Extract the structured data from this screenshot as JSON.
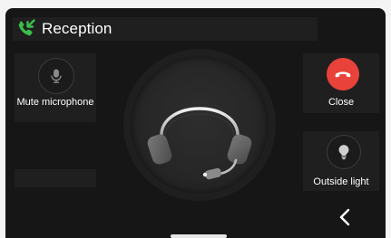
{
  "header": {
    "title": "Reception",
    "icon": "incoming-call-icon",
    "icon_color": "#3bbf4a"
  },
  "actions": {
    "mute": {
      "label": "Mute microphone",
      "icon": "microphone-icon"
    },
    "close": {
      "label": "Close",
      "icon": "hang-up-icon",
      "color": "#e8423a"
    },
    "light": {
      "label": "Outside light",
      "icon": "light-bulb-icon"
    }
  },
  "center": {
    "icon": "headset-icon"
  },
  "nav": {
    "back_icon": "chevron-left-icon"
  }
}
